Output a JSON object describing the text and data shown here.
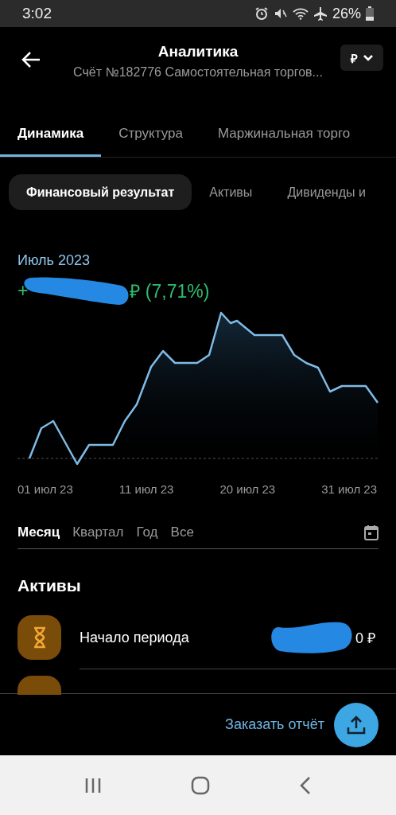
{
  "status_bar": {
    "time": "3:02",
    "battery": "26%"
  },
  "header": {
    "title": "Аналитика",
    "subtitle": "Счёт №182776 Самостоятельная торгов...",
    "currency": "₽"
  },
  "tabs": [
    {
      "label": "Динамика",
      "selected": true
    },
    {
      "label": "Структура",
      "selected": false
    },
    {
      "label": "Маржинальная торго",
      "selected": false
    }
  ],
  "chips": [
    {
      "label": "Финансовый результат",
      "selected": true
    },
    {
      "label": "Активы",
      "selected": false
    },
    {
      "label": "Дивиденды и",
      "selected": false
    }
  ],
  "result": {
    "period": "Июль 2023",
    "sign": "+",
    "value_tail": "₽ (7,71%)"
  },
  "chart": {
    "x_labels": [
      "01 июл 23",
      "11 июл 23",
      "20 июл 23",
      "31 июл 23"
    ]
  },
  "periods": [
    {
      "label": "Месяц",
      "selected": true
    },
    {
      "label": "Квартал",
      "selected": false
    },
    {
      "label": "Год",
      "selected": false
    },
    {
      "label": "Все",
      "selected": false
    }
  ],
  "assets": {
    "title": "Активы",
    "rows": [
      {
        "label": "Начало периода",
        "value_tail": "0 ₽"
      }
    ]
  },
  "footer": {
    "link": "Заказать отчёт"
  }
}
